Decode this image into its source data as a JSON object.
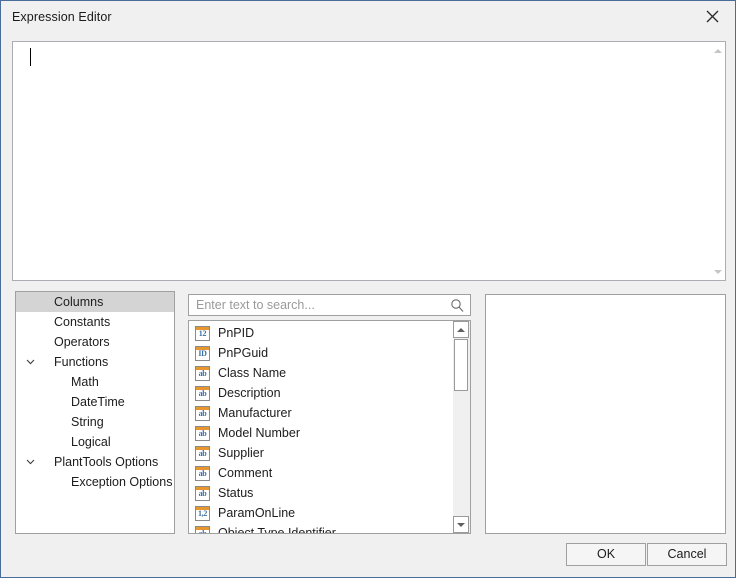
{
  "window": {
    "title": "Expression Editor",
    "close_icon": "close-icon",
    "border_color": "#4a6c9b",
    "background": "#f0f0f0"
  },
  "editor": {
    "value": "",
    "caret_visible": true,
    "scrollbar": {
      "up_icon": "scroll-up-arrow-icon",
      "down_icon": "scroll-down-arrow-icon",
      "enabled": false
    }
  },
  "tree": {
    "items": [
      {
        "label": "Columns",
        "indent": 0,
        "expander": "",
        "selected": true
      },
      {
        "label": "Constants",
        "indent": 0,
        "expander": "",
        "selected": false
      },
      {
        "label": "Operators",
        "indent": 0,
        "expander": "",
        "selected": false
      },
      {
        "label": "Functions",
        "indent": 0,
        "expander": "down",
        "selected": false
      },
      {
        "label": "Math",
        "indent": 1,
        "expander": "",
        "selected": false
      },
      {
        "label": "DateTime",
        "indent": 1,
        "expander": "",
        "selected": false
      },
      {
        "label": "String",
        "indent": 1,
        "expander": "",
        "selected": false
      },
      {
        "label": "Logical",
        "indent": 1,
        "expander": "",
        "selected": false
      },
      {
        "label": "PlantTools Options",
        "indent": 0,
        "expander": "down",
        "selected": false
      },
      {
        "label": "Exception Options",
        "indent": 1,
        "expander": "",
        "selected": false
      }
    ],
    "selection_color": "#d4d4d4"
  },
  "search": {
    "value": "",
    "placeholder": "Enter text to search...",
    "icon": "search-icon"
  },
  "list": {
    "rows": [
      {
        "label": "PnPID",
        "type": "12"
      },
      {
        "label": "PnPGuid",
        "type": "ID"
      },
      {
        "label": "Class Name",
        "type": "ab"
      },
      {
        "label": "Description",
        "type": "ab"
      },
      {
        "label": "Manufacturer",
        "type": "ab"
      },
      {
        "label": "Model Number",
        "type": "ab"
      },
      {
        "label": "Supplier",
        "type": "ab"
      },
      {
        "label": "Comment",
        "type": "ab"
      },
      {
        "label": "Status",
        "type": "ab"
      },
      {
        "label": "ParamOnLine",
        "type": "1,2"
      },
      {
        "label": "Object Type Identifier",
        "type": "ab"
      }
    ],
    "icon_accent": "#e8962f",
    "icon_text_color": "#3a6ea5",
    "scrollbar": {
      "up_icon": "scroll-up-arrow-icon",
      "down_icon": "scroll-down-arrow-icon"
    }
  },
  "preview": {
    "text": ""
  },
  "footer": {
    "ok_label": "OK",
    "cancel_label": "Cancel"
  }
}
